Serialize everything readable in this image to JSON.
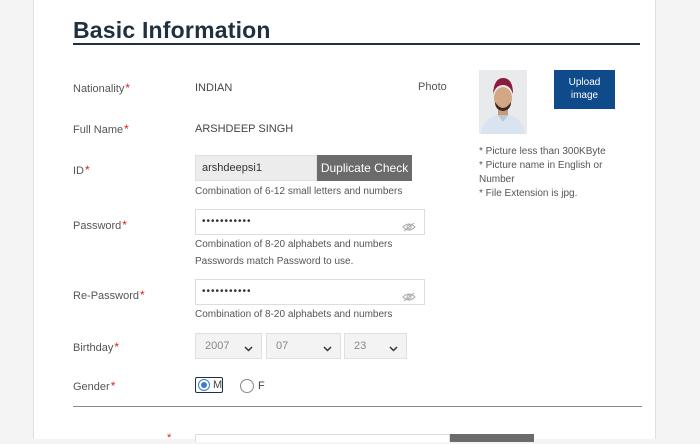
{
  "section_title": "Basic Information",
  "required_mark": "*",
  "nationality": {
    "label": "Nationality",
    "value": "INDIAN"
  },
  "full_name": {
    "label": "Full Name",
    "value": "ARSHDEEP SINGH"
  },
  "id_field": {
    "label": "ID",
    "value": "arshdeepsi1",
    "button": "Duplicate Check",
    "hint": "Combination of 6-12 small letters and numbers"
  },
  "password": {
    "label": "Password",
    "value": "•••••••••••",
    "hint1": "Combination of 8-20 alphabets and numbers",
    "hint2": "Passwords match Password to use."
  },
  "repassword": {
    "label": "Re-Password",
    "value": "•••••••••••",
    "hint": "Combination of 8-20 alphabets and numbers"
  },
  "birthday": {
    "label": "Birthday",
    "year": "2007",
    "month": "07",
    "day": "23"
  },
  "gender": {
    "label": "Gender",
    "options": [
      "M",
      "F"
    ],
    "selected": "M"
  },
  "photo": {
    "label": "Photo",
    "upload_label": "Upload image",
    "notes": [
      "* Picture less than 300KByte",
      "* Picture name in English or Number",
      "* File Extension is jpg."
    ]
  },
  "colors": {
    "title": "#1f3040",
    "required": "#d9241c",
    "upload_button": "#0f4a8a",
    "duplicate_button": "#6b6b6b"
  },
  "icons": {
    "eye": "eye-slash-icon",
    "select": "chevron-down-icon"
  }
}
